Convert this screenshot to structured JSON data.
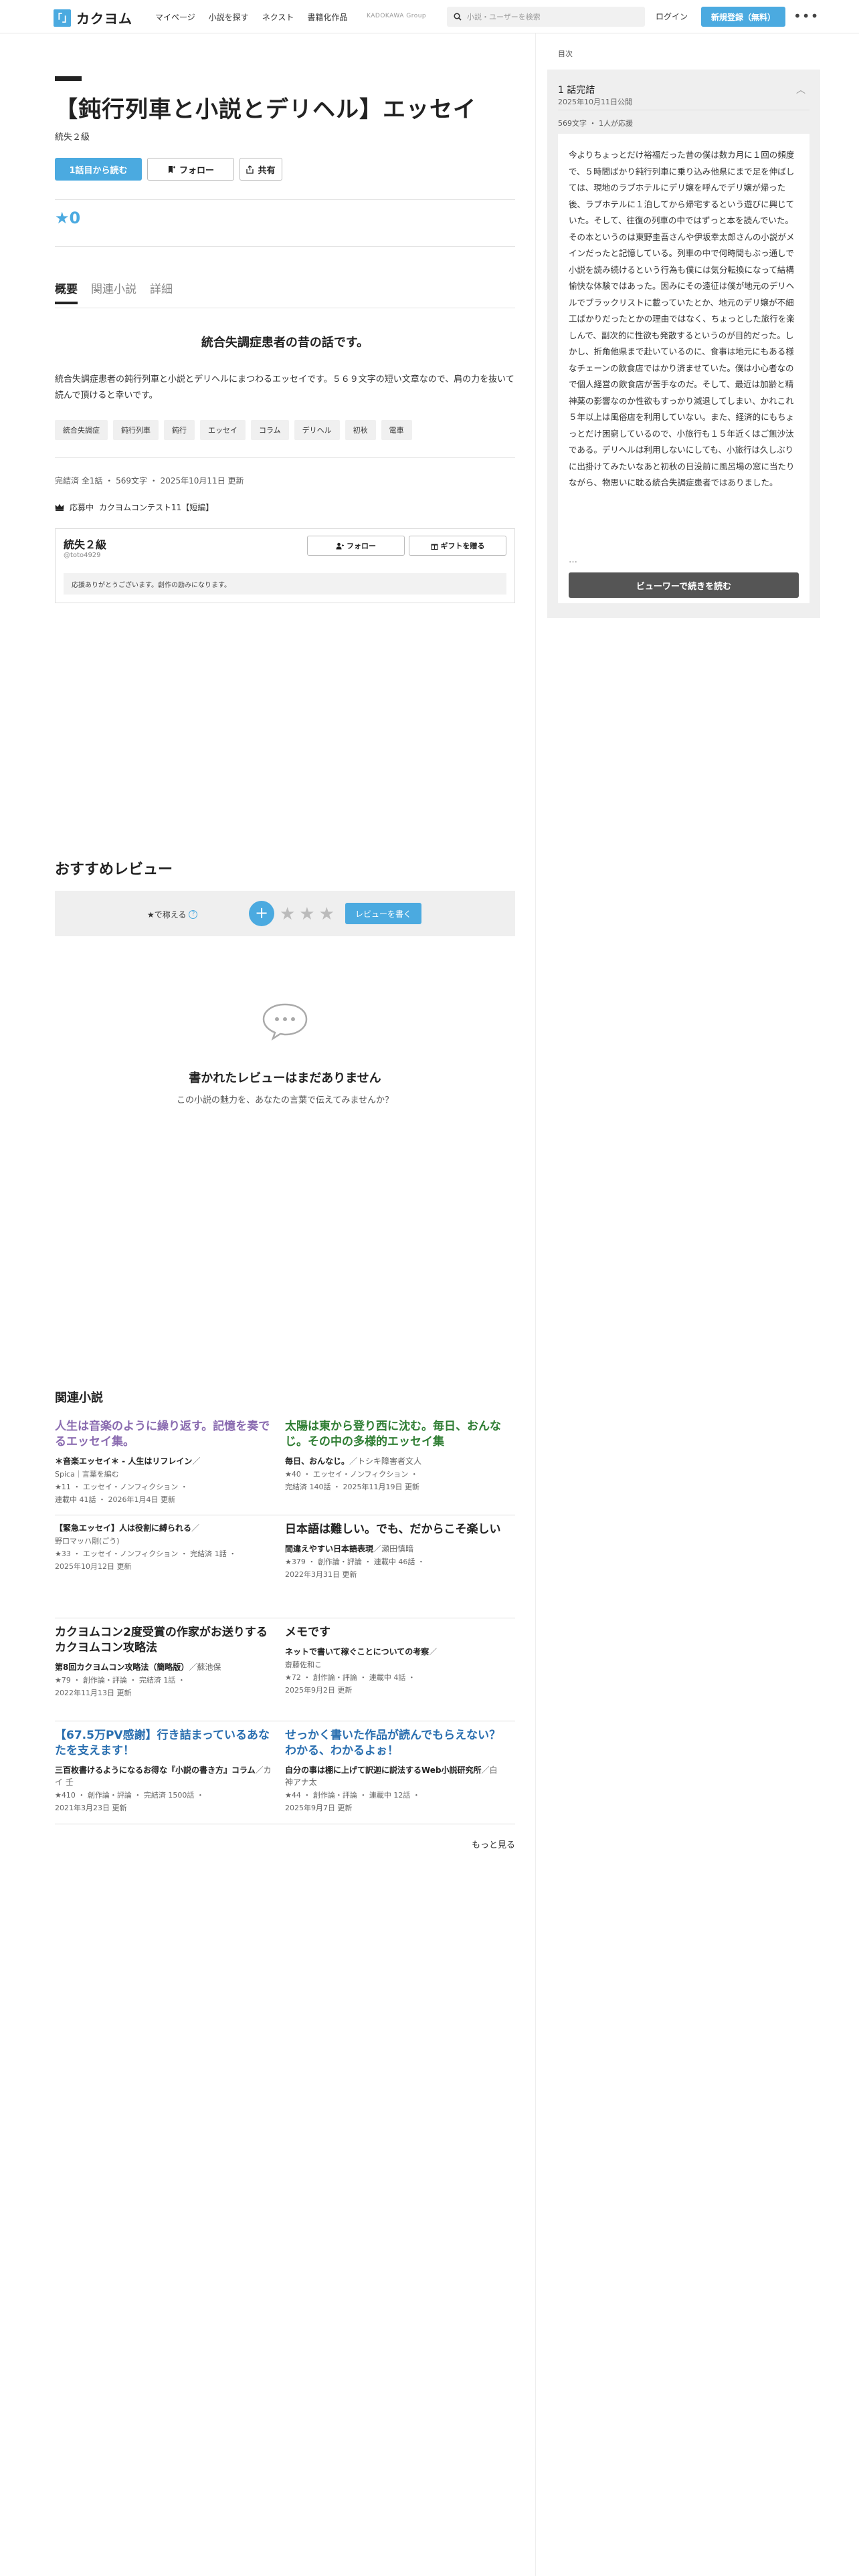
{
  "header": {
    "logo_mark": "「」",
    "logo_text": "カクヨム",
    "nav": [
      "マイページ",
      "小説を探す",
      "ネクスト",
      "書籍化作品"
    ],
    "group": "KADOKAWA Group",
    "search_placeholder": "小説・ユーザーを検索",
    "login": "ログイン",
    "signup": "新規登録（無料）",
    "more": "•••"
  },
  "work": {
    "title": "【鈍行列車と小説とデリヘル】エッセイ",
    "author": "統失２級",
    "read_button": "1話目から読む",
    "follow_button": "フォロー",
    "share_button": "共有",
    "star_score": "★0",
    "tabs": [
      "概要",
      "関連小説",
      "詳細"
    ],
    "catchphrase": "統合失調症患者の昔の話です。",
    "intro": "統合失調症患者の鈍行列車と小説とデリヘルにまつわるエッセイです。５６９文字の短い文章なので、肩の力を抜いて読んで頂けると幸いです。",
    "tags": [
      "統合失調症",
      "鈍行列車",
      "鈍行",
      "エッセイ",
      "コラム",
      "デリヘル",
      "初秋",
      "電車"
    ],
    "meta": "完結済 全1話 ・ 569文字 ・ 2025年10月11日 更新",
    "contest_label": "応募中",
    "contest": "カクヨムコンテスト11【短編】"
  },
  "author_box": {
    "name": "統失２級",
    "id": "@toto4929",
    "follow": "フォロー",
    "gift": "ギフトを贈る",
    "message": "応援ありがとうございます。創作の励みになります。"
  },
  "reviews": {
    "title": "おすすめレビュー",
    "label": "★で称える",
    "help": "?",
    "plus": "+",
    "stars": "★★★",
    "write_button": "レビューを書く",
    "empty_title": "書かれたレビューはまだありません",
    "empty_sub": "この小説の魅力を、あなたの言葉で伝えてみませんか？"
  },
  "related": {
    "title": "関連小説",
    "items": [
      {
        "title": "人生は音楽のように繰り返す。記憶を奏でるエッセイ集。",
        "color": "#8a6bb0",
        "catch": "＊音楽エッセイ＊ - 人生はリフレイン",
        "author": "／",
        "sub": "Spica｜言葉を編む",
        "meta1": "★11 ・ エッセイ・ノンフィクション ・",
        "meta2": "連載中 41話 ・ 2026年1月4日 更新"
      },
      {
        "title": "太陽は東から登り西に沈む。毎日、おんなじ。その中の多様的エッセイ集",
        "color": "#2e7d32",
        "catch": "毎日、おんなじ。",
        "author": "／トシキ障害者文人",
        "sub": "",
        "meta1": "★40 ・ エッセイ・ノンフィクション ・",
        "meta2": "完結済 140話 ・ 2025年11月19日 更新"
      },
      {
        "title": "",
        "color": "#222222",
        "catch": "【緊急エッセイ】人は役割に縛られる",
        "author": "／",
        "sub": "野口マッハ剛(ごう)",
        "meta1": "★33 ・ エッセイ・ノンフィクション ・ 完結済 1話 ・",
        "meta2": "2025年10月12日 更新"
      },
      {
        "title": "日本語は難しい。でも、だからこそ楽しい",
        "color": "#222222",
        "catch": "間違えやすい日本語表現",
        "author": "／瀬田慎暗",
        "sub": "",
        "meta1": "★379 ・ 創作論・評論 ・ 連載中 46話 ・",
        "meta2": "2022年3月31日 更新"
      },
      {
        "title": "カクヨムコン2度受賞の作家がお送りするカクヨムコン攻略法",
        "color": "#222222",
        "catch": "第8回カクヨムコン攻略法（簡略版）",
        "author": "／蘇池保",
        "sub": "",
        "meta1": "★79 ・ 創作論・評論 ・ 完結済 1話 ・",
        "meta2": "2022年11月13日 更新"
      },
      {
        "title": "メモです",
        "color": "#222222",
        "catch": "ネットで書いて稼ぐことについての考察",
        "author": "／",
        "sub": "齋藤佐和こ",
        "meta1": "★72 ・ 創作論・評論 ・ 連載中 4話 ・",
        "meta2": "2025年9月2日 更新"
      },
      {
        "title": "【67.5万PV感謝】行き詰まっているあなたを支えます！",
        "color": "#2a6fb0",
        "catch": "三百枚書けるようになるお得な『小説の書き方』コラム",
        "author": "／カイ 壬",
        "sub": "",
        "meta1": "★410 ・ 創作論・評論 ・ 完結済 1500話 ・",
        "meta2": "2021年3月23日 更新"
      },
      {
        "title": "せっかく書いた作品が読んでもらえない？ わかる、わかるよぉ！",
        "color": "#2a6fb0",
        "catch": "自分の事は棚に上げて訳迦に説法するWeb小説研究所",
        "author": "／白神アナ太",
        "sub": "",
        "meta1": "★44 ・ 創作論・評論 ・ 連載中 12話 ・",
        "meta2": "2025年9月7日 更新"
      }
    ],
    "more": "もっと見る"
  },
  "sidebar": {
    "label": "目次",
    "episode": "1 話完結",
    "date": "2025年10月11日公開",
    "chev": "︿",
    "meta": "569文字 ・ 1人が応援",
    "text": "今よりちょっとだけ裕福だった昔の僕は数カ月に１回の頻度で、５時間ばかり鈍行列車に乗り込み他県にまで足を伸ばしては、現地のラブホテルにデリ嬢を呼んでデリ嬢が帰った後、ラブホテルに１泊してから帰宅するという遊びに興じていた。そして、往復の列車の中ではずっと本を読んでいた。その本というのは東野圭吾さんや伊坂幸太郎さんの小説がメインだったと記憶している。列車の中で何時間もぶっ通しで小説を読み続けるという行為も僕には気分転換になって結構愉快な体験ではあった。因みにその遠征は僕が地元のデリヘルでブラックリストに載っていたとか、地元のデリ嬢が不細工ばかりだったとかの理由ではなく、ちょっとした旅行を楽しんで、副次的に性欲も発散するというのが目的だった。しかし、折角他県まで赴いているのに、食事は地元にもある様なチェーンの飲食店ではかり済ませていた。僕は小心者なので個人経営の飲食店が苦手なのだ。そして、最近は加齢と精神薬の影響なのか性欲もすっかり減退してしまい、かれこれ５年以上は風俗店を利用していない。また、経済的にもちょっとだけ困窮しているので、小旅行も１５年近くはご無沙汰である。デリヘルは利用しないにしても、小旅行は久しぶりに出掛けてみたいなあと初秋の日没前に風呂場の窓に当たりながら、物思いに耽る統合失調症患者ではありました。",
    "ellipsis": "…",
    "button": "ビューワーで続きを読む"
  }
}
